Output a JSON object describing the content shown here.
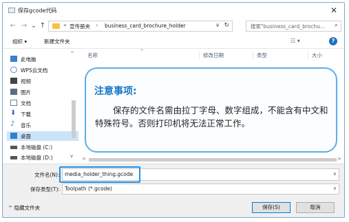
{
  "window": {
    "title": "保存gcode代码",
    "close_glyph": "✕"
  },
  "nav": {
    "back": "←",
    "forward": "→",
    "dropdown": "⌄",
    "up": "↑",
    "overflow": "«",
    "breadcrumbs": [
      "宣传册夹",
      "business_card_brochure_holder"
    ],
    "separator": "›",
    "address_dropdown": "∨",
    "refresh": "↻",
    "search_placeholder": "搜索\"business_card_brochu...",
    "search_icon_glyph": "⌕"
  },
  "toolbar": {
    "organize": "组织 ▾",
    "new_folder": "新建文件夹",
    "view": "☷ ▾",
    "help": "?"
  },
  "sidebar": {
    "scroll_up": "^",
    "scroll_down": "v",
    "items": [
      {
        "label": "此电脑",
        "icon": "computer-icon",
        "color": "#3a7fcf"
      },
      {
        "label": "WPS云文档",
        "icon": "cloud-icon",
        "color": "#5a8fd0"
      },
      {
        "label": "视频",
        "icon": "video-icon",
        "color": "#444444"
      },
      {
        "label": "图片",
        "icon": "picture-icon",
        "color": "#5a6e86"
      },
      {
        "label": "文档",
        "icon": "document-icon",
        "color": "#6a7f96"
      },
      {
        "label": "下载",
        "icon": "download-icon",
        "color": "#1f6fc2"
      },
      {
        "label": "音乐",
        "icon": "music-icon",
        "color": "#1f6fc2"
      },
      {
        "label": "桌面",
        "icon": "desktop-icon",
        "color": "#2f7fd0"
      },
      {
        "label": "本地磁盘 (C:)",
        "icon": "drive-icon",
        "color": "#555555"
      },
      {
        "label": "本地磁盘 (D:)",
        "icon": "drive-icon",
        "color": "#555555"
      }
    ],
    "selected_index": 7
  },
  "columns": {
    "name": "名称",
    "modified": "修改日期",
    "type": "类型",
    "size": "大小",
    "sort_caret": "^"
  },
  "hscroll": {
    "left": "<",
    "right": ">"
  },
  "form": {
    "filename_label": "文件名(N):",
    "filename_value": "media_holder_thing.gcode",
    "filetype_label": "保存类型(T):",
    "filetype_value": "Toolpath (*.gcode)",
    "dropdown_glyph": "∨",
    "hide_folders": "^ 隐藏文件夹",
    "save": "保存(S)",
    "cancel": "取消"
  },
  "note": {
    "title": "注意事项:",
    "body": "保存的文件名需由拉丁字母、数字组成，不能含有中文和特殊符号。否则打印机将无法正常工作。"
  },
  "colors": {
    "accent": "#1e90e8",
    "note_title": "#1677c9",
    "selected": "#cce4f7"
  }
}
